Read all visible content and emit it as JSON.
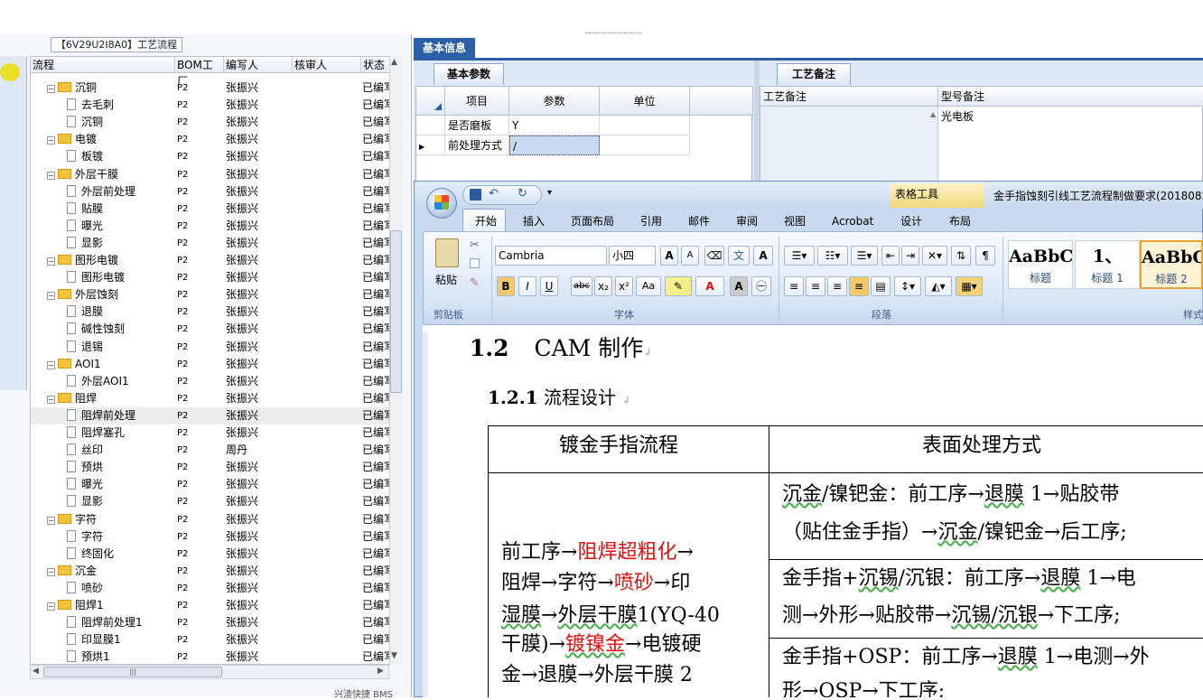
{
  "left_panel": {
    "group_title": "【6V29U2I8A0】工艺流程",
    "columns": [
      "流程",
      "BOM工厂",
      "编写人",
      "核审人",
      "状态"
    ],
    "rows": [
      {
        "indent": 0,
        "type": "folder",
        "name": "沉铜",
        "bom": "P2",
        "writer": "张振兴",
        "status": "已编写"
      },
      {
        "indent": 1,
        "type": "doc",
        "name": "去毛刺",
        "bom": "P2",
        "writer": "张振兴",
        "status": "已编写"
      },
      {
        "indent": 1,
        "type": "doc",
        "name": "沉铜",
        "bom": "P2",
        "writer": "张振兴",
        "status": "已编写"
      },
      {
        "indent": 0,
        "type": "folder",
        "name": "电镀",
        "bom": "P2",
        "writer": "张振兴",
        "status": "已编写"
      },
      {
        "indent": 1,
        "type": "doc",
        "name": "板镀",
        "bom": "P2",
        "writer": "张振兴",
        "status": "已编写"
      },
      {
        "indent": 0,
        "type": "folder",
        "name": "外层干膜",
        "bom": "P2",
        "writer": "张振兴",
        "status": "已编写"
      },
      {
        "indent": 1,
        "type": "doc",
        "name": "外层前处理",
        "bom": "P2",
        "writer": "张振兴",
        "status": "已编写"
      },
      {
        "indent": 1,
        "type": "doc",
        "name": "贴膜",
        "bom": "P2",
        "writer": "张振兴",
        "status": "已编写"
      },
      {
        "indent": 1,
        "type": "doc",
        "name": "曝光",
        "bom": "P2",
        "writer": "张振兴",
        "status": "已编写"
      },
      {
        "indent": 1,
        "type": "doc",
        "name": "显影",
        "bom": "P2",
        "writer": "张振兴",
        "status": "已编写"
      },
      {
        "indent": 0,
        "type": "folder",
        "name": "图形电镀",
        "bom": "P2",
        "writer": "张振兴",
        "status": "已编写"
      },
      {
        "indent": 1,
        "type": "doc",
        "name": "图形电镀",
        "bom": "P2",
        "writer": "张振兴",
        "status": "已编写"
      },
      {
        "indent": 0,
        "type": "folder",
        "name": "外层蚀刻",
        "bom": "P2",
        "writer": "张振兴",
        "status": "已编写"
      },
      {
        "indent": 1,
        "type": "doc",
        "name": "退膜",
        "bom": "P2",
        "writer": "张振兴",
        "status": "已编写"
      },
      {
        "indent": 1,
        "type": "doc",
        "name": "碱性蚀刻",
        "bom": "P2",
        "writer": "张振兴",
        "status": "已编写"
      },
      {
        "indent": 1,
        "type": "doc",
        "name": "退锡",
        "bom": "P2",
        "writer": "张振兴",
        "status": "已编写"
      },
      {
        "indent": 0,
        "type": "folder",
        "name": "AOI1",
        "bom": "P2",
        "writer": "张振兴",
        "status": "已编写"
      },
      {
        "indent": 1,
        "type": "doc",
        "name": "外层AOI1",
        "bom": "P2",
        "writer": "张振兴",
        "status": "已编写"
      },
      {
        "indent": 0,
        "type": "folder",
        "name": "阻焊",
        "bom": "P2",
        "writer": "张振兴",
        "status": "已编写"
      },
      {
        "indent": 1,
        "type": "doc",
        "name": "阻焊前处理",
        "bom": "P2",
        "writer": "张振兴",
        "status": "已编写",
        "selected": true
      },
      {
        "indent": 1,
        "type": "doc",
        "name": "阻焊塞孔",
        "bom": "P2",
        "writer": "张振兴",
        "status": "已编写"
      },
      {
        "indent": 1,
        "type": "doc",
        "name": "丝印",
        "bom": "P2",
        "writer": "周丹",
        "status": "已编写"
      },
      {
        "indent": 1,
        "type": "doc",
        "name": "预烘",
        "bom": "P2",
        "writer": "张振兴",
        "status": "已编写"
      },
      {
        "indent": 1,
        "type": "doc",
        "name": "曝光",
        "bom": "P2",
        "writer": "张振兴",
        "status": "已编写"
      },
      {
        "indent": 1,
        "type": "doc",
        "name": "显影",
        "bom": "P2",
        "writer": "张振兴",
        "status": "已编写"
      },
      {
        "indent": 0,
        "type": "folder",
        "name": "字符",
        "bom": "P2",
        "writer": "张振兴",
        "status": "已编写"
      },
      {
        "indent": 1,
        "type": "doc",
        "name": "字符",
        "bom": "P2",
        "writer": "张振兴",
        "status": "已编写"
      },
      {
        "indent": 1,
        "type": "doc",
        "name": "终固化",
        "bom": "P2",
        "writer": "张振兴",
        "status": "已编写"
      },
      {
        "indent": 0,
        "type": "folder",
        "name": "沉金",
        "bom": "P2",
        "writer": "张振兴",
        "status": "已编写"
      },
      {
        "indent": 1,
        "type": "doc",
        "name": "喷砂",
        "bom": "P2",
        "writer": "张振兴",
        "status": "已编写"
      },
      {
        "indent": 0,
        "type": "folder",
        "name": "阻焊1",
        "bom": "P2",
        "writer": "张振兴",
        "status": "已编写"
      },
      {
        "indent": 1,
        "type": "doc",
        "name": "阻焊前处理1",
        "bom": "P2",
        "writer": "张振兴",
        "status": "已编写"
      },
      {
        "indent": 1,
        "type": "doc",
        "name": "印显膜1",
        "bom": "P2",
        "writer": "张振兴",
        "status": "已编写"
      },
      {
        "indent": 1,
        "type": "doc",
        "name": "预烘1",
        "bom": "P2",
        "writer": "张振兴",
        "status": "已编写"
      }
    ],
    "status_bar": "兴渣快捷 BMS"
  },
  "basic_info": {
    "tab": "基本信息",
    "params_tab": "基本参数",
    "params_columns": [
      "项目",
      "参数",
      "单位"
    ],
    "params_rows": [
      {
        "item": "是否磨板",
        "value": "Y",
        "unit": ""
      },
      {
        "item": "前处理方式",
        "value": "/",
        "unit": ""
      }
    ],
    "notes_tab": "工艺备注",
    "notes_columns": [
      "工艺备注",
      "型号备注"
    ],
    "model_note": "光电板"
  },
  "word": {
    "context_tab": "表格工具",
    "doc_title": "金手指蚀刻引线工艺流程制做要求(2018082",
    "tabs": [
      "开始",
      "插入",
      "页面布局",
      "引用",
      "邮件",
      "审阅",
      "视图",
      "Acrobat",
      "设计",
      "布局"
    ],
    "clipboard": {
      "paste": "粘贴",
      "group": "剪贴板"
    },
    "font": {
      "name": "Cambria",
      "size": "小四",
      "group": "字体"
    },
    "paragraph_group": "段落",
    "styles": [
      {
        "preview": "AaBbC",
        "name": "标题"
      },
      {
        "preview": "1、",
        "name": "标题 1"
      },
      {
        "preview": "AaBbC",
        "name": "标题 2"
      }
    ],
    "styles_group": "样式"
  },
  "document": {
    "h12_num": "1.2",
    "h12_text": "CAM 制作",
    "h121_num": "1.2.1",
    "h121_text": "流程设计",
    "table": {
      "col1_header": "镀金手指流程",
      "col2_header": "表面处理方式",
      "left_lines": [
        "前工序→阻焊超粗化→",
        "阻焊→字符→喷砂→印",
        "湿膜→外层干膜1(YQ-40",
        "干膜)→镀镍金→电镀硬",
        "金→退膜→外层干膜 2"
      ],
      "right_cells": [
        [
          "沉金/镍钯金：前工序→退膜 1→贴胶带",
          "（贴住金手指）→沉金/镍钯金→后工序;"
        ],
        [
          "金手指+沉锡/沉银：前工序→退膜 1→电",
          "测→外形→贴胶带→沉锡/沉银→下工序;"
        ],
        [
          "金手指+OSP：前工序→退膜 1→电测→外",
          "形→OSP→下工序;"
        ]
      ]
    }
  }
}
